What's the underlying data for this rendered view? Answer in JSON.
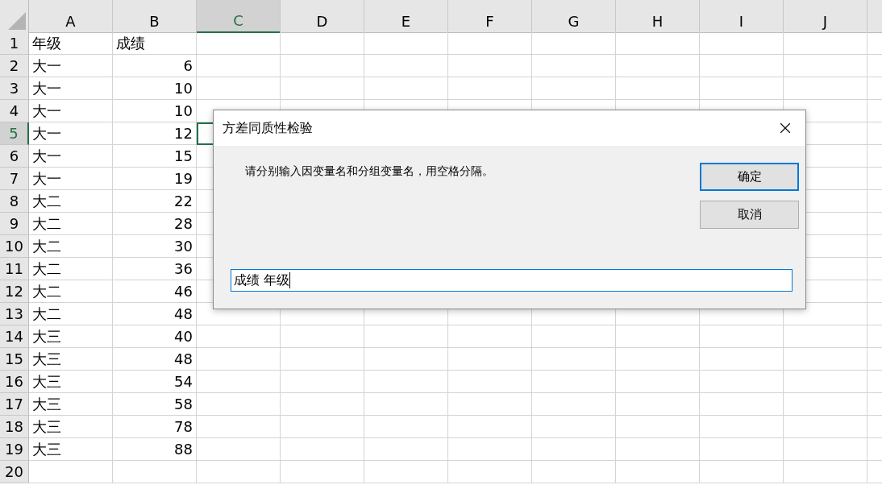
{
  "columns": [
    {
      "label": "A",
      "selected": false
    },
    {
      "label": "B",
      "selected": false
    },
    {
      "label": "C",
      "selected": true
    },
    {
      "label": "D",
      "selected": false
    },
    {
      "label": "E",
      "selected": false
    },
    {
      "label": "F",
      "selected": false
    },
    {
      "label": "G",
      "selected": false
    },
    {
      "label": "H",
      "selected": false
    },
    {
      "label": "I",
      "selected": false
    },
    {
      "label": "J",
      "selected": false
    }
  ],
  "rows": [
    {
      "number": "1",
      "selected": false,
      "cells": [
        {
          "kind": "text",
          "text": "年级"
        },
        {
          "kind": "text",
          "text": "成绩"
        }
      ]
    },
    {
      "number": "2",
      "selected": false,
      "cells": [
        {
          "kind": "text",
          "text": "大一"
        },
        {
          "kind": "number",
          "text": "6"
        }
      ]
    },
    {
      "number": "3",
      "selected": false,
      "cells": [
        {
          "kind": "text",
          "text": "大一"
        },
        {
          "kind": "number",
          "text": "10"
        }
      ]
    },
    {
      "number": "4",
      "selected": false,
      "cells": [
        {
          "kind": "text",
          "text": "大一"
        },
        {
          "kind": "number",
          "text": "10"
        }
      ]
    },
    {
      "number": "5",
      "selected": true,
      "cells": [
        {
          "kind": "text",
          "text": "大一"
        },
        {
          "kind": "number",
          "text": "12"
        }
      ]
    },
    {
      "number": "6",
      "selected": false,
      "cells": [
        {
          "kind": "text",
          "text": "大一"
        },
        {
          "kind": "number",
          "text": "15"
        }
      ]
    },
    {
      "number": "7",
      "selected": false,
      "cells": [
        {
          "kind": "text",
          "text": "大一"
        },
        {
          "kind": "number",
          "text": "19"
        }
      ]
    },
    {
      "number": "8",
      "selected": false,
      "cells": [
        {
          "kind": "text",
          "text": "大二"
        },
        {
          "kind": "number",
          "text": "22"
        }
      ]
    },
    {
      "number": "9",
      "selected": false,
      "cells": [
        {
          "kind": "text",
          "text": "大二"
        },
        {
          "kind": "number",
          "text": "28"
        }
      ]
    },
    {
      "number": "10",
      "selected": false,
      "cells": [
        {
          "kind": "text",
          "text": "大二"
        },
        {
          "kind": "number",
          "text": "30"
        }
      ]
    },
    {
      "number": "11",
      "selected": false,
      "cells": [
        {
          "kind": "text",
          "text": "大二"
        },
        {
          "kind": "number",
          "text": "36"
        }
      ]
    },
    {
      "number": "12",
      "selected": false,
      "cells": [
        {
          "kind": "text",
          "text": "大二"
        },
        {
          "kind": "number",
          "text": "46"
        }
      ]
    },
    {
      "number": "13",
      "selected": false,
      "cells": [
        {
          "kind": "text",
          "text": "大二"
        },
        {
          "kind": "number",
          "text": "48"
        }
      ]
    },
    {
      "number": "14",
      "selected": false,
      "cells": [
        {
          "kind": "text",
          "text": "大三"
        },
        {
          "kind": "number",
          "text": "40"
        }
      ]
    },
    {
      "number": "15",
      "selected": false,
      "cells": [
        {
          "kind": "text",
          "text": "大三"
        },
        {
          "kind": "number",
          "text": "48"
        }
      ]
    },
    {
      "number": "16",
      "selected": false,
      "cells": [
        {
          "kind": "text",
          "text": "大三"
        },
        {
          "kind": "number",
          "text": "54"
        }
      ]
    },
    {
      "number": "17",
      "selected": false,
      "cells": [
        {
          "kind": "text",
          "text": "大三"
        },
        {
          "kind": "number",
          "text": "58"
        }
      ]
    },
    {
      "number": "18",
      "selected": false,
      "cells": [
        {
          "kind": "text",
          "text": "大三"
        },
        {
          "kind": "number",
          "text": "78"
        }
      ]
    },
    {
      "number": "19",
      "selected": false,
      "cells": [
        {
          "kind": "text",
          "text": "大三"
        },
        {
          "kind": "number",
          "text": "88"
        }
      ]
    },
    {
      "number": "20",
      "selected": false,
      "cells": []
    }
  ],
  "dialog": {
    "title": "方差同质性检验",
    "message": "请分别输入因变量名和分组变量名，用空格分隔。",
    "buttons": [
      {
        "label": "确定",
        "default": true
      },
      {
        "label": "取消",
        "default": false
      }
    ],
    "input": {
      "value": "成绩 年级",
      "focused": true
    }
  }
}
